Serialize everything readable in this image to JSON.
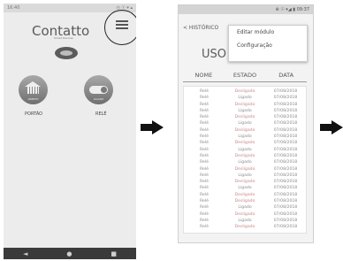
{
  "phone1": {
    "status_left": "16:40",
    "status_right": "◷ ☉ ▾ ▴",
    "brand": "Contatto",
    "brand_sub": "Smart Devices",
    "devices": [
      {
        "tag": "ABERTO",
        "label": "PORTÃO"
      },
      {
        "tag": "LIGADO",
        "label": "RELÉ"
      }
    ],
    "nav": [
      "◄",
      "●",
      "■"
    ]
  },
  "phone2": {
    "status": "⊕ ☉ ▾◢ ▮ 09:37",
    "back_label": "< HISTÓRICO",
    "menu_items": [
      "Editar módulo",
      "Configuração"
    ],
    "section_title": "USO",
    "columns": [
      "NOME",
      "ESTADO",
      "DATA"
    ],
    "rows": [
      [
        "Relé",
        "Desligado",
        "07/08/2018"
      ],
      [
        "Relé",
        "Ligado",
        "07/08/2018"
      ],
      [
        "Relé",
        "Desligado",
        "07/08/2018"
      ],
      [
        "Relé",
        "Ligado",
        "07/08/2018"
      ],
      [
        "Relé",
        "Desligado",
        "07/08/2018"
      ],
      [
        "Relé",
        "Ligado",
        "07/08/2018"
      ],
      [
        "Relé",
        "Desligado",
        "07/08/2018"
      ],
      [
        "Relé",
        "Ligado",
        "07/08/2018"
      ],
      [
        "Relé",
        "Desligado",
        "07/08/2018"
      ],
      [
        "Relé",
        "Ligado",
        "07/08/2018"
      ],
      [
        "Relé",
        "Desligado",
        "07/08/2018"
      ],
      [
        "Relé",
        "Ligado",
        "07/08/2018"
      ],
      [
        "Relé",
        "Desligado",
        "07/08/2018"
      ],
      [
        "Relé",
        "Ligado",
        "07/08/2018"
      ],
      [
        "Relé",
        "Desligado",
        "07/08/2018"
      ],
      [
        "Relé",
        "Ligado",
        "07/08/2018"
      ],
      [
        "Relé",
        "Desligado",
        "07/08/2018"
      ],
      [
        "Relé",
        "Desligado",
        "07/08/2018"
      ],
      [
        "Relé",
        "Ligado",
        "07/08/2018"
      ],
      [
        "Relé",
        "Desligado",
        "07/08/2018"
      ],
      [
        "Relé",
        "Ligado",
        "07/08/2018"
      ],
      [
        "Relé",
        "Desligado",
        "07/08/2018"
      ]
    ]
  }
}
